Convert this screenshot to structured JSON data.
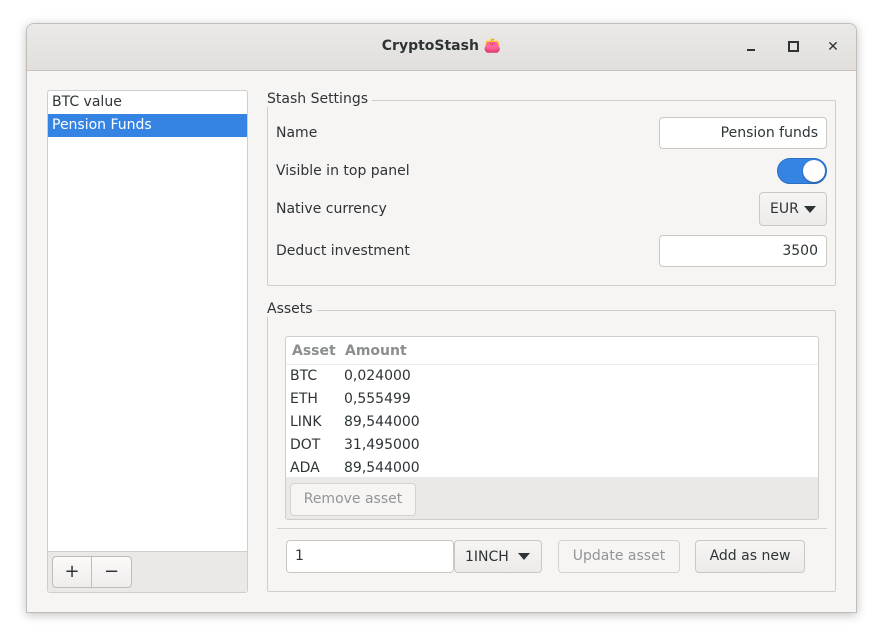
{
  "window": {
    "title": "CryptoStash 👛",
    "minimize_label": "minimize",
    "maximize_label": "maximize",
    "close_label": "close"
  },
  "sidebar": {
    "items": [
      {
        "label": "BTC value",
        "selected": false
      },
      {
        "label": "Pension Funds",
        "selected": true
      }
    ],
    "add_label": "+",
    "remove_label": "−"
  },
  "settings": {
    "frame_title": "Stash Settings",
    "name_label": "Name",
    "name_value": "Pension funds",
    "visible_label": "Visible in top panel",
    "visible_on": true,
    "currency_label": "Native currency",
    "currency_value": "EUR",
    "deduct_label": "Deduct investment",
    "deduct_value": "3500"
  },
  "assets": {
    "frame_title": "Assets",
    "columns": [
      "Asset",
      "Amount"
    ],
    "rows": [
      {
        "asset": "BTC",
        "amount": "0,024000"
      },
      {
        "asset": "ETH",
        "amount": "0,555499"
      },
      {
        "asset": "LINK",
        "amount": "89,544000"
      },
      {
        "asset": "DOT",
        "amount": "31,495000"
      },
      {
        "asset": "ADA",
        "amount": "89,544000"
      }
    ],
    "remove_label": "Remove asset",
    "amount_input_value": "1",
    "asset_select_value": "1INCH",
    "update_label": "Update asset",
    "add_new_label": "Add as new"
  },
  "colors": {
    "accent": "#3584e4",
    "window_bg": "#f6f5f4"
  }
}
